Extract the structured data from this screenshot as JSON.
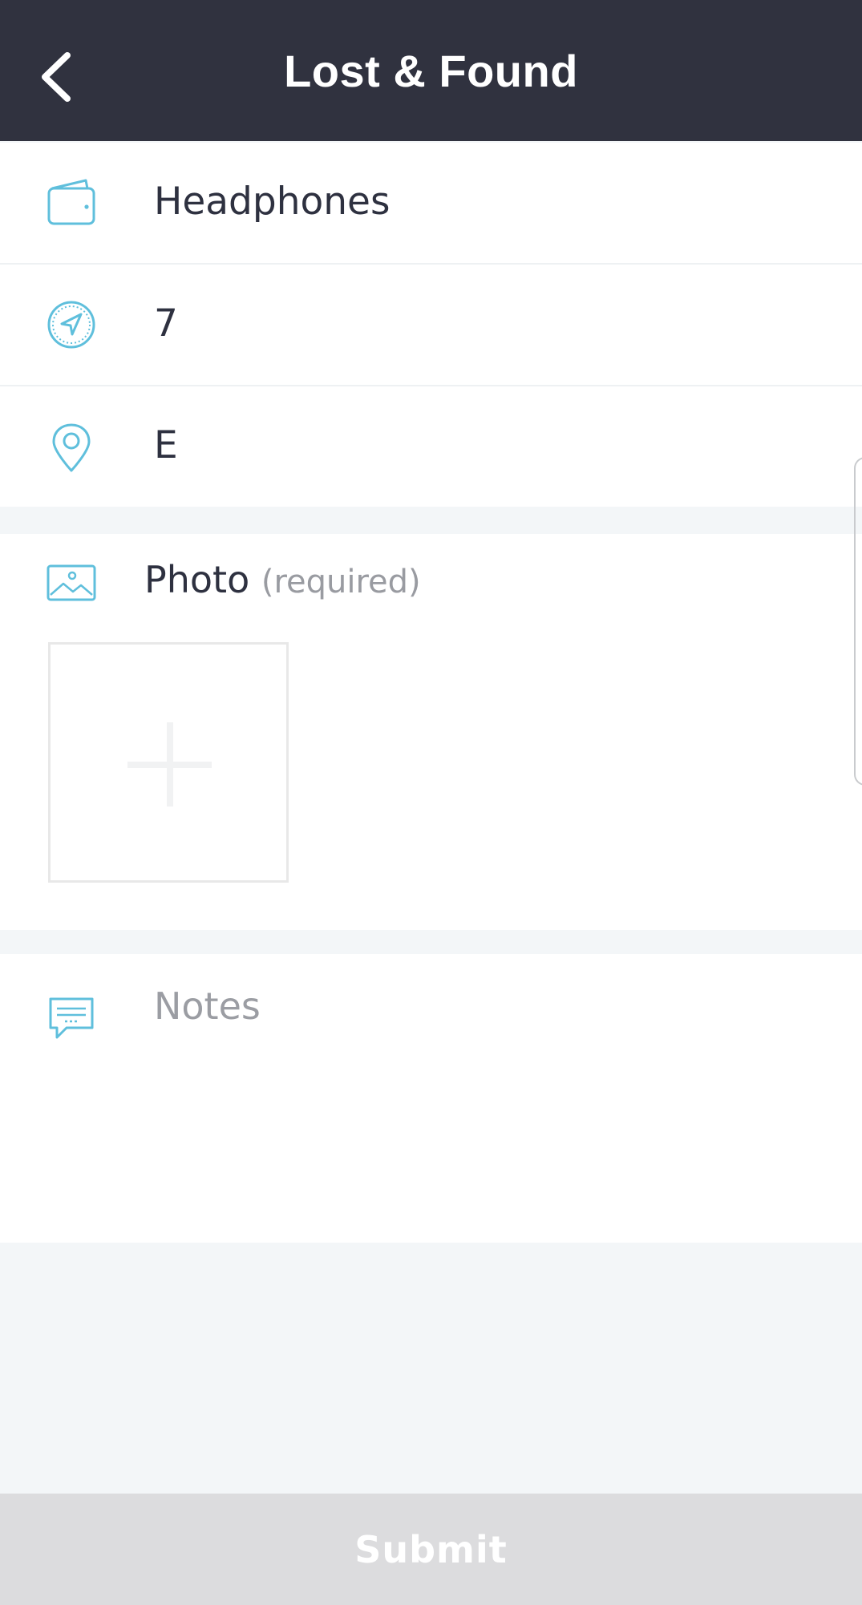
{
  "header": {
    "title": "Lost & Found",
    "back_icon": "chevron-left-icon"
  },
  "form": {
    "item": {
      "icon": "wallet-icon",
      "value": "Headphones"
    },
    "number": {
      "icon": "navigation-icon",
      "value": "7"
    },
    "location": {
      "icon": "map-pin-icon",
      "value": "E"
    },
    "photo": {
      "icon": "image-icon",
      "label": "Photo",
      "required_label": "(required)",
      "add_icon": "plus-icon"
    },
    "notes": {
      "icon": "chat-bubble-icon",
      "placeholder": "Notes"
    }
  },
  "submit": {
    "label": "Submit"
  },
  "colors": {
    "header_bg": "#30323f",
    "icon_accent": "#5fbfdc",
    "submit_bg": "#dcdcde",
    "page_bg": "#f3f6f8"
  }
}
